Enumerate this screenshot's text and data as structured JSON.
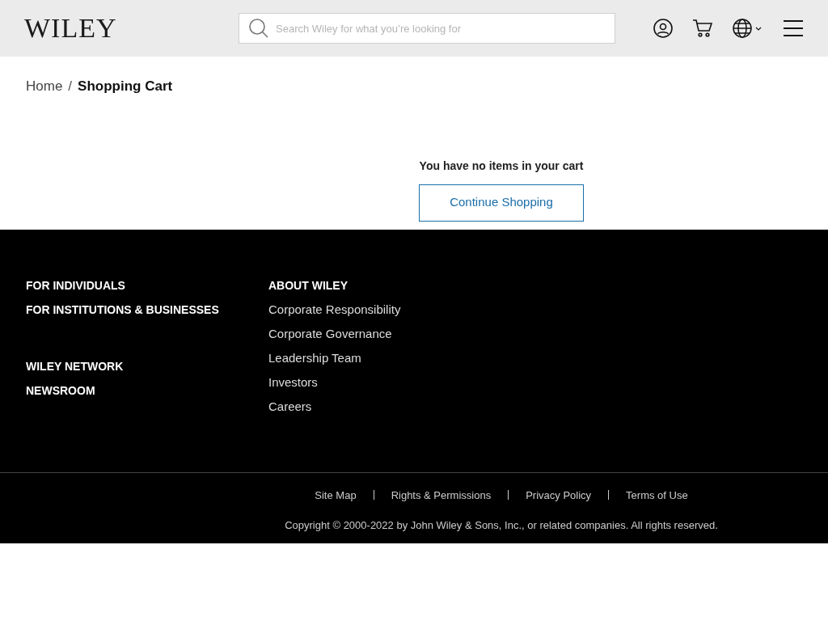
{
  "header": {
    "logo": "WILEY",
    "search": {
      "placeholder": "Search Wiley for what you’re looking for"
    }
  },
  "breadcrumb": [
    {
      "label": "Home",
      "current": false
    },
    {
      "label": "Shopping Cart",
      "current": true
    }
  ],
  "breadcrumb_separator": "/",
  "cart": {
    "message": "You have no items in your cart",
    "button": "Continue Shopping"
  },
  "footer": {
    "column_1": [
      [
        "FOR INDIVIDUALS",
        "FOR INSTITUTIONS & BUSINESSES"
      ],
      [
        "WILEY NETWORK",
        "NEWSROOM"
      ]
    ],
    "column_2": {
      "heading": "ABOUT WILEY",
      "links": [
        "Corporate Responsibility",
        "Corporate Governance",
        "Leadership Team",
        "Investors",
        "Careers"
      ]
    },
    "legal_links": [
      "Site Map",
      "Rights & Permissions",
      "Privacy Policy",
      "Terms of Use"
    ],
    "copyright": "Copyright © 2000-2022 by John Wiley & Sons, Inc., or related companies. All rights reserved."
  }
}
